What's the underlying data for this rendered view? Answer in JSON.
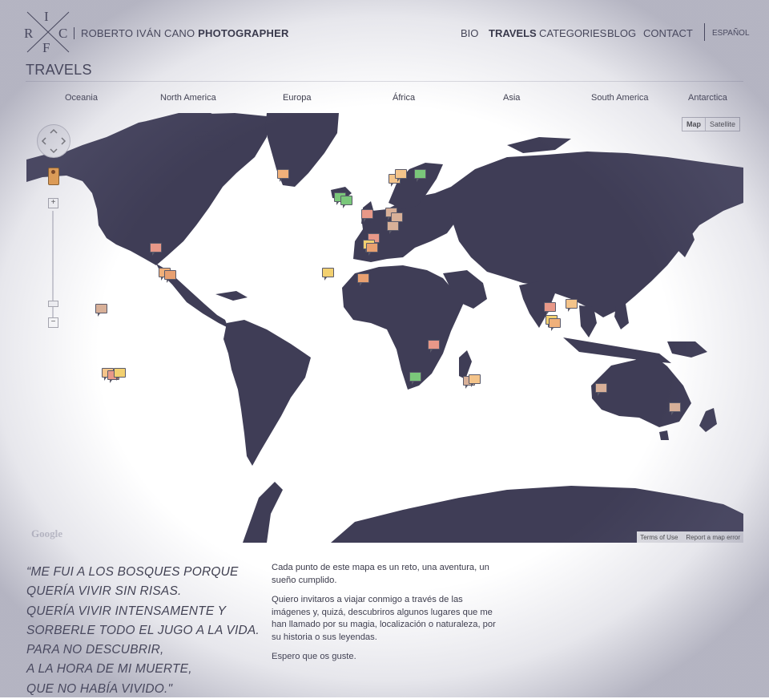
{
  "logo": {
    "letters": [
      "I",
      "R",
      "C",
      "F"
    ]
  },
  "brand": {
    "name": "ROBERTO IVÁN CANO",
    "suffix": "PHOTOGRAPHER"
  },
  "nav": {
    "items": [
      {
        "label": "BIO",
        "active": false
      },
      {
        "label": "TRAVELS",
        "active": true
      },
      {
        "label": "CATEGORIES",
        "active": false
      },
      {
        "label": "BLOG",
        "active": false
      },
      {
        "label": "CONTACT",
        "active": false
      }
    ],
    "language": "ESPAÑOL"
  },
  "page": {
    "title": "TRAVELS"
  },
  "tabs": [
    "Oceania",
    "North America",
    "Europa",
    "África",
    "Asia",
    "South America",
    "Antarctica"
  ],
  "map": {
    "type_buttons": [
      "Map",
      "Satellite"
    ],
    "selected_type": "Map",
    "zoom_in": "+",
    "zoom_out": "−",
    "attribution": "Google",
    "footer_links": [
      "Terms of Use",
      "Report a map error"
    ],
    "land_color": "#3f3d56",
    "marker_colors": [
      "#f0b07a",
      "#e8a070",
      "#f4c48a",
      "#d8b098",
      "#7ac77a",
      "#e89888",
      "#f2d070"
    ]
  },
  "quote": {
    "lines": [
      "“ME FUI A LOS BOSQUES PORQUE",
      "QUERÍA VIVIR SIN RISAS.",
      "QUERÍA VIVIR INTENSAMENTE Y",
      "SORBERLE TODO EL JUGO A LA VIDA.",
      "PARA NO DESCUBRIR,",
      "A LA HORA DE MI MUERTE,",
      "QUE NO HABÍA VIVIDO.\""
    ]
  },
  "intro": {
    "paragraphs": [
      "Cada punto de este mapa es un reto, una aventura, un sueño cumplido.",
      "Quiero invitaros a viajar conmigo a través de las imágenes y, quizá, descubriros algunos lugares que me han llamado por su magia, localización o naturaleza, por su historia o sus leyendas.",
      "Espero que os guste."
    ]
  }
}
